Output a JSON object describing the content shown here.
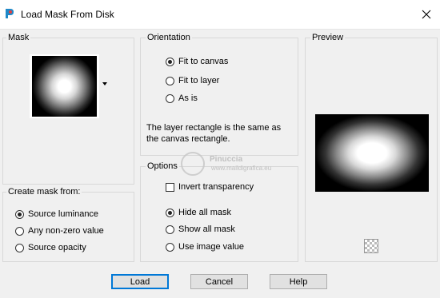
{
  "window": {
    "title": "Load Mask From Disk"
  },
  "mask": {
    "group_label": "Mask"
  },
  "create_mask": {
    "group_label": "Create mask from:",
    "options": [
      {
        "label": "Source luminance",
        "checked": true
      },
      {
        "label": "Any non-zero value",
        "checked": false
      },
      {
        "label": "Source opacity",
        "checked": false
      }
    ]
  },
  "orientation": {
    "group_label": "Orientation",
    "options": [
      {
        "label": "Fit to canvas",
        "checked": true
      },
      {
        "label": "Fit to layer",
        "checked": false
      },
      {
        "label": "As is",
        "checked": false
      }
    ],
    "info": "The layer rectangle is the same as the canvas rectangle."
  },
  "options": {
    "group_label": "Options",
    "invert_label": "Invert transparency",
    "invert_checked": false,
    "hide": [
      {
        "label": "Hide all mask",
        "checked": true
      },
      {
        "label": "Show all mask",
        "checked": false
      },
      {
        "label": "Use image value",
        "checked": false
      }
    ]
  },
  "preview": {
    "group_label": "Preview"
  },
  "buttons": {
    "load": "Load",
    "cancel": "Cancel",
    "help": "Help"
  },
  "watermark": {
    "name": "Pinuccia",
    "url": "www.maildigrafica.eu"
  },
  "colors": {
    "accent": "#0078d7",
    "background": "#f0f0f0"
  }
}
